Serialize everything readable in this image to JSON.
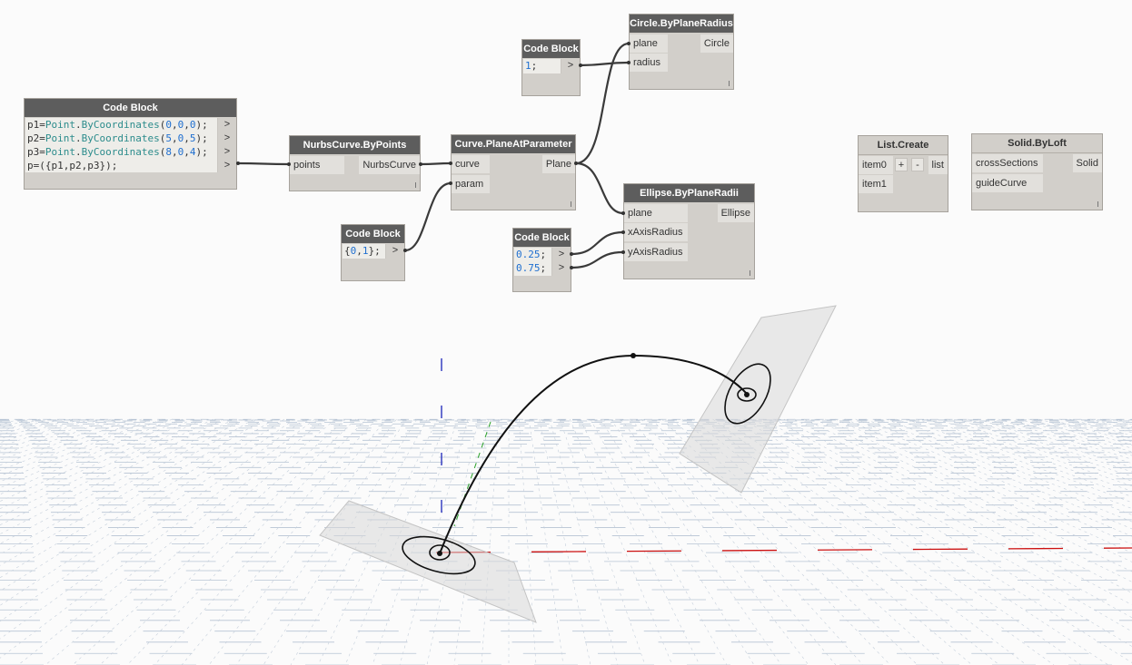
{
  "nodes": {
    "code_main": {
      "title": "Code Block",
      "lines": [
        [
          {
            "t": "p1=",
            "c": "plain"
          },
          {
            "t": "Point",
            "c": "fn"
          },
          {
            "t": ".",
            "c": "plain"
          },
          {
            "t": "ByCoordinates",
            "c": "fn"
          },
          {
            "t": "(",
            "c": "plain"
          },
          {
            "t": "0",
            "c": "num"
          },
          {
            "t": ",",
            "c": "plain"
          },
          {
            "t": "0",
            "c": "num"
          },
          {
            "t": ",",
            "c": "plain"
          },
          {
            "t": "0",
            "c": "num"
          },
          {
            "t": ");",
            "c": "plain"
          }
        ],
        [
          {
            "t": "p2=",
            "c": "plain"
          },
          {
            "t": "Point",
            "c": "fn"
          },
          {
            "t": ".",
            "c": "plain"
          },
          {
            "t": "ByCoordinates",
            "c": "fn"
          },
          {
            "t": "(",
            "c": "plain"
          },
          {
            "t": "5",
            "c": "num"
          },
          {
            "t": ",",
            "c": "plain"
          },
          {
            "t": "0",
            "c": "num"
          },
          {
            "t": ",",
            "c": "plain"
          },
          {
            "t": "5",
            "c": "num"
          },
          {
            "t": ");",
            "c": "plain"
          }
        ],
        [
          {
            "t": "p3=",
            "c": "plain"
          },
          {
            "t": "Point",
            "c": "fn"
          },
          {
            "t": ".",
            "c": "plain"
          },
          {
            "t": "ByCoordinates",
            "c": "fn"
          },
          {
            "t": "(",
            "c": "plain"
          },
          {
            "t": "8",
            "c": "num"
          },
          {
            "t": ",",
            "c": "plain"
          },
          {
            "t": "0",
            "c": "num"
          },
          {
            "t": ",",
            "c": "plain"
          },
          {
            "t": "4",
            "c": "num"
          },
          {
            "t": ");",
            "c": "plain"
          }
        ],
        [
          {
            "t": "p=({p1,p2,p3});",
            "c": "plain"
          }
        ]
      ],
      "arrow": ">"
    },
    "nurbs": {
      "title": "NurbsCurve.ByPoints",
      "in_points": "points",
      "out": "NurbsCurve"
    },
    "plane_at_param": {
      "title": "Curve.PlaneAtParameter",
      "in_curve": "curve",
      "in_param": "param",
      "out": "Plane"
    },
    "code_param": {
      "title": "Code Block",
      "lines": [
        [
          {
            "t": "{",
            "c": "plain"
          },
          {
            "t": "0",
            "c": "num"
          },
          {
            "t": ",",
            "c": "plain"
          },
          {
            "t": "1",
            "c": "num"
          },
          {
            "t": "};",
            "c": "plain"
          }
        ]
      ],
      "arrow": ">"
    },
    "code_radius": {
      "title": "Code Block",
      "lines": [
        [
          {
            "t": "1",
            "c": "num"
          },
          {
            "t": ";",
            "c": "plain"
          }
        ]
      ],
      "arrow": ">"
    },
    "circle": {
      "title": "Circle.ByPlaneRadius",
      "in_plane": "plane",
      "in_radius": "radius",
      "out": "Circle"
    },
    "code_radii": {
      "title": "Code Block",
      "lines": [
        [
          {
            "t": "0.25",
            "c": "num"
          },
          {
            "t": ";",
            "c": "plain"
          }
        ],
        [
          {
            "t": "0.75",
            "c": "num"
          },
          {
            "t": ";",
            "c": "plain"
          }
        ]
      ],
      "arrow": ">"
    },
    "ellipse": {
      "title": "Ellipse.ByPlaneRadii",
      "in_plane": "plane",
      "in_x": "xAxisRadius",
      "in_y": "yAxisRadius",
      "out": "Ellipse"
    },
    "list_create": {
      "title": "List.Create",
      "in_item0": "item0",
      "in_item1": "item1",
      "plus": "+",
      "minus": "-",
      "out": "list"
    },
    "loft": {
      "title": "Solid.ByLoft",
      "in_cross": "crossSections",
      "in_guide": "guideCurve",
      "out": "Solid"
    }
  },
  "colors": {
    "node_header": "#5d5d5d",
    "node_body": "#d2cfca",
    "wire": "#3a3a3a",
    "grid": "#b7c4d4",
    "x_axis": "#d01010",
    "y_axis": "#1a24b8",
    "z_axis": "#28a028"
  }
}
